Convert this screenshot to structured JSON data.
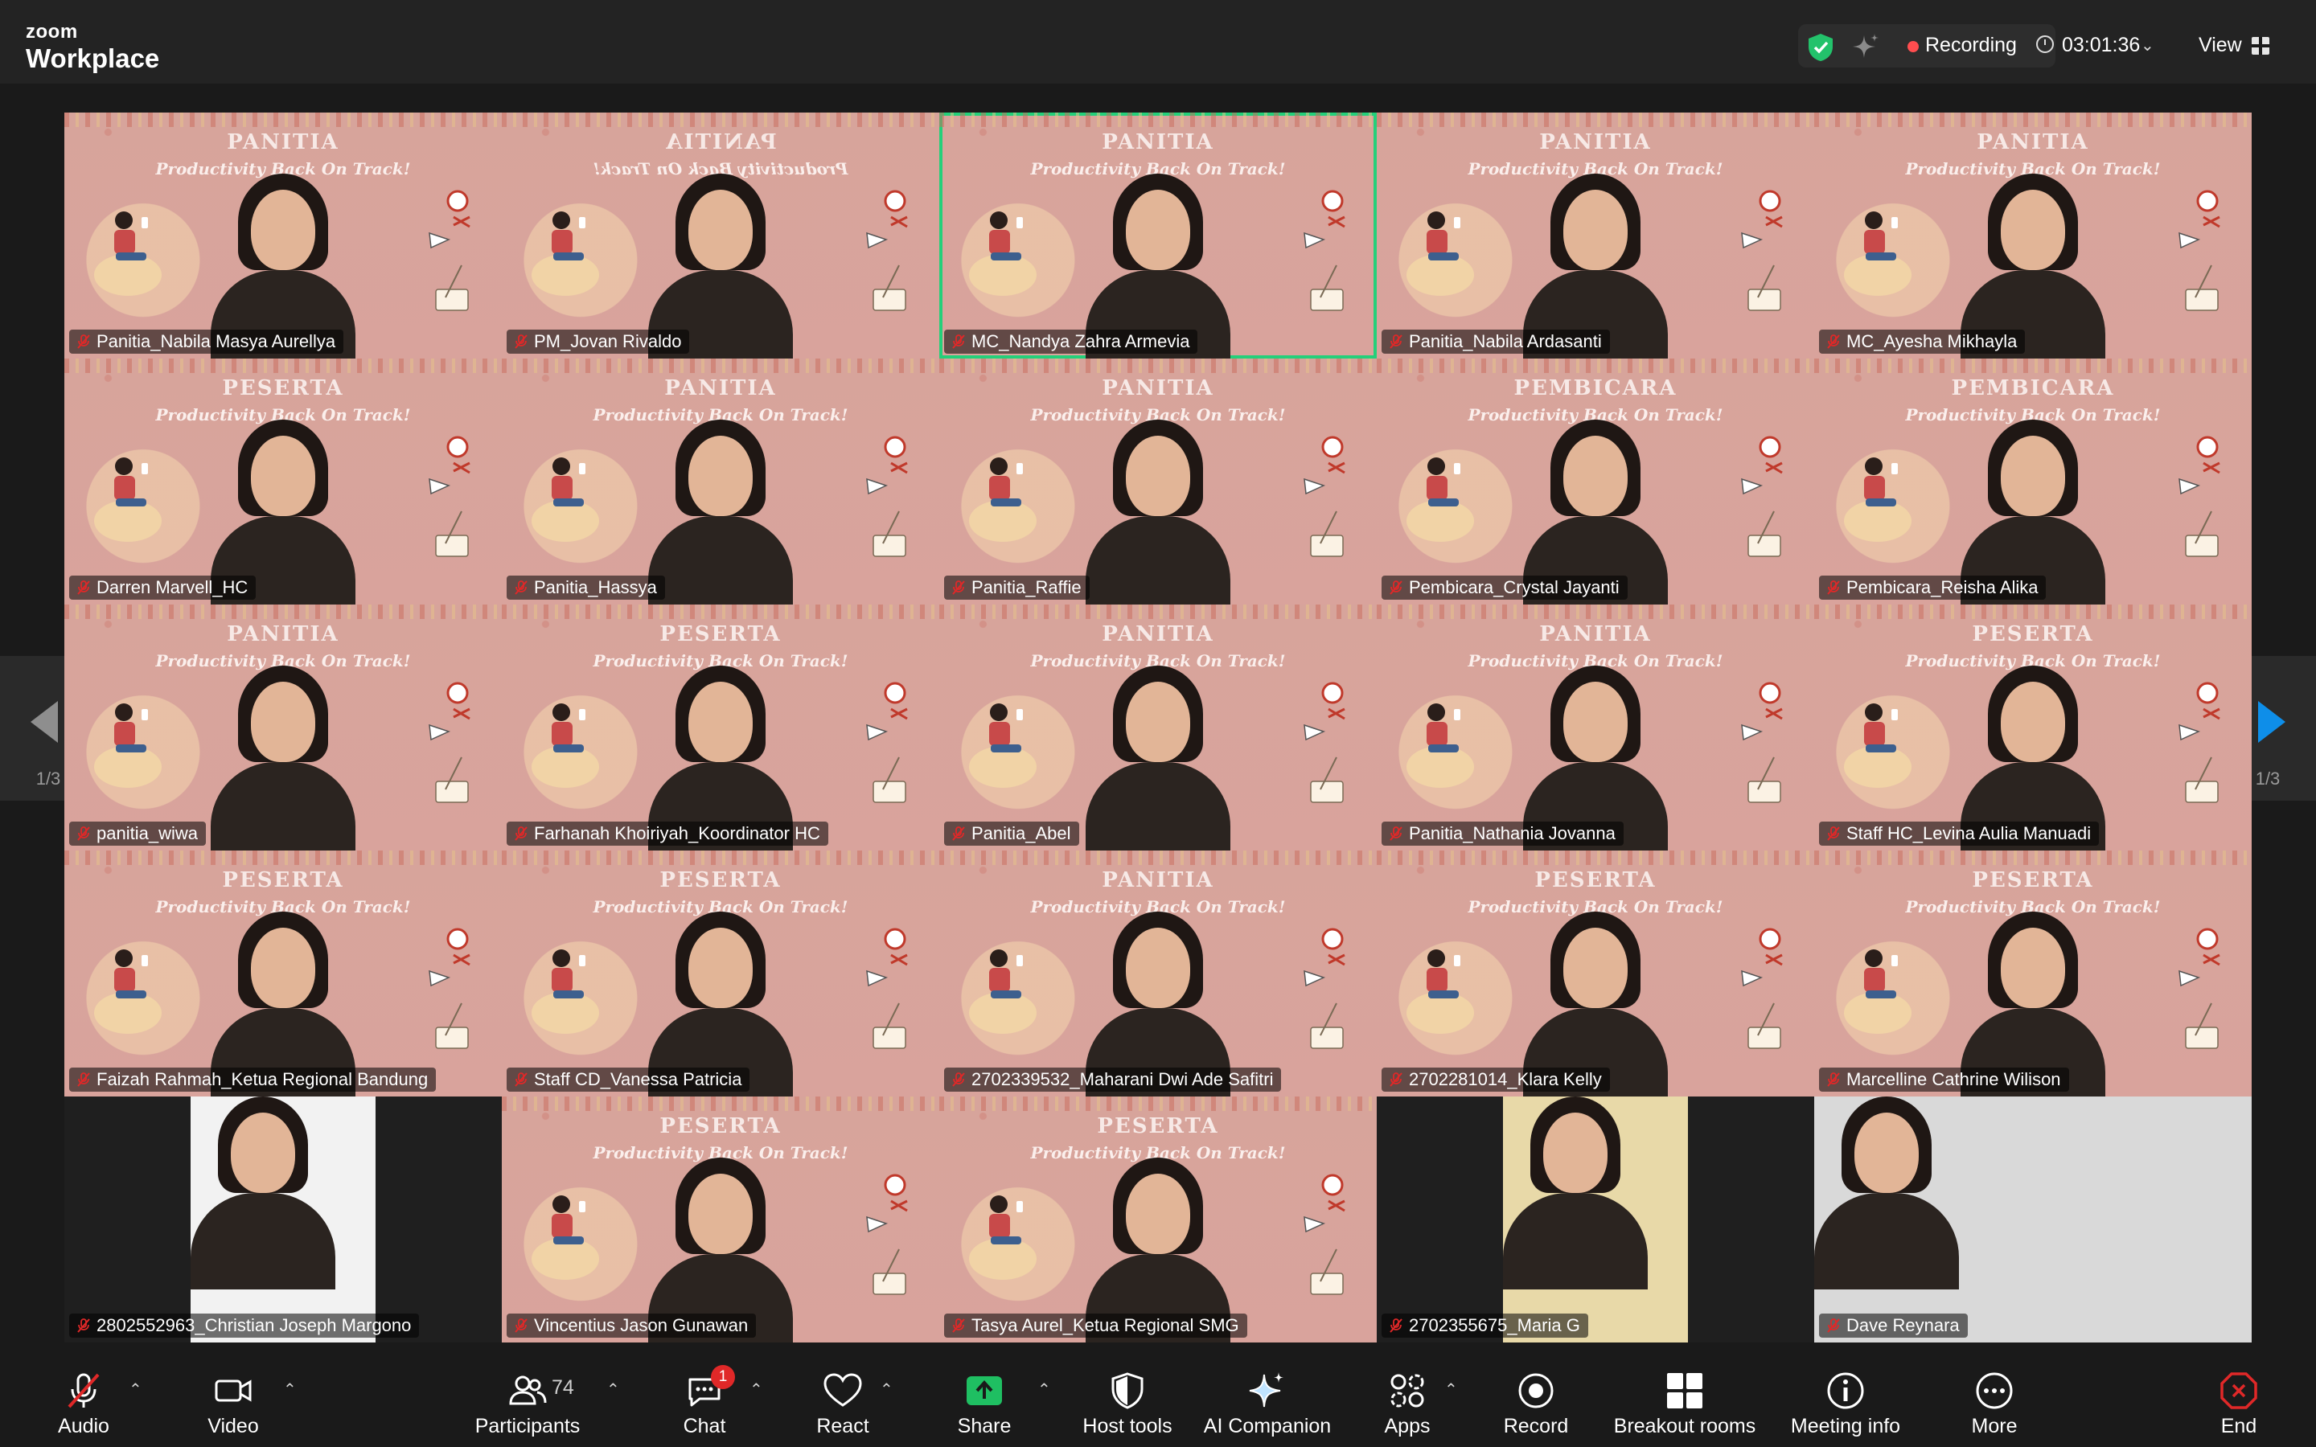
{
  "app": {
    "brand_top": "zoom",
    "brand_bottom": "Workplace"
  },
  "header": {
    "recording_label": "Recording",
    "timer": "03:01:36",
    "view_label": "View",
    "colors": {
      "shield": "#23c26b",
      "recording_dot": "#ff4d4f"
    }
  },
  "gallery": {
    "page_left": "1/3",
    "page_right": "1/3",
    "tiles": [
      {
        "name": "Panitia_Nabila Masya Aurellya",
        "banner": "PANITIA",
        "tagline": "Productivity Back On Track!"
      },
      {
        "name": "PM_Jovan Rivaldo",
        "banner": "PANITIA",
        "tagline": "Productivity Back On Track!"
      },
      {
        "name": "MC_Nandya Zahra Armevia",
        "banner": "PANITIA",
        "tagline": "Productivity Back On Track!"
      },
      {
        "name": "Panitia_Nabila Ardasanti",
        "banner": "PANITIA",
        "tagline": "Productivity Back On Track!"
      },
      {
        "name": "MC_Ayesha Mikhayla",
        "banner": "PANITIA",
        "tagline": "Productivity Back On Track!"
      },
      {
        "name": "Darren Marvell_HC",
        "banner": "PESERTA",
        "tagline": "Productivity Back On Track!"
      },
      {
        "name": "Panitia_Hassya",
        "banner": "PANITIA",
        "tagline": "Productivity Back On Track!"
      },
      {
        "name": "Panitia_Raffie",
        "banner": "PANITIA",
        "tagline": "Productivity Back On Track!"
      },
      {
        "name": "Pembicara_Crystal Jayanti",
        "banner": "PEMBICARA",
        "tagline": "Productivity Back On Track!"
      },
      {
        "name": "Pembicara_Reisha Alika",
        "banner": "PEMBICARA",
        "tagline": "Productivity Back On Track!"
      },
      {
        "name": "panitia_wiwa",
        "banner": "PANITIA",
        "tagline": "Productivity Back On Track!"
      },
      {
        "name": "Farhanah Khoiriyah_Koordinator HC",
        "banner": "PESERTA",
        "tagline": "Productivity Back On Track!"
      },
      {
        "name": "Panitia_Abel",
        "banner": "PANITIA",
        "tagline": "Productivity Back On Track!"
      },
      {
        "name": "Panitia_Nathania Jovanna",
        "banner": "PANITIA",
        "tagline": "Productivity Back On Track!"
      },
      {
        "name": "Staff HC_Levina Aulia Manuadi",
        "banner": "PESERTA",
        "tagline": "Productivity Back On Track!"
      },
      {
        "name": "Faizah Rahmah_Ketua Regional Bandung",
        "banner": "PESERTA",
        "tagline": "Productivity Back On Track!"
      },
      {
        "name": "Staff CD_Vanessa Patricia",
        "banner": "PESERTA",
        "tagline": "Productivity Back On Track!"
      },
      {
        "name": "2702339532_Maharani Dwi Ade Safitri",
        "banner": "PANITIA",
        "tagline": "Productivity Back On Track!"
      },
      {
        "name": "2702281014_Klara Kelly",
        "banner": "PESERTA",
        "tagline": "Productivity Back On Track!"
      },
      {
        "name": "Marcelline Cathrine Wilison",
        "banner": "PESERTA",
        "tagline": "Productivity Back On Track!"
      },
      {
        "name": "2802552963_Christian Joseph Margono",
        "banner": "",
        "tagline": ""
      },
      {
        "name": "Vincentius Jason Gunawan",
        "banner": "PESERTA",
        "tagline": "Productivity Back On Track!"
      },
      {
        "name": "Tasya Aurel_Ketua Regional SMG",
        "banner": "PESERTA",
        "tagline": "Productivity Back On Track!"
      },
      {
        "name": "2702355675_Maria G",
        "banner": "",
        "tagline": ""
      },
      {
        "name": "Dave Reynara",
        "banner": "",
        "tagline": ""
      }
    ],
    "active_speaker_color": "#24d07a"
  },
  "toolbar": {
    "audio": "Audio",
    "video": "Video",
    "participants": "Participants",
    "participants_count": "74",
    "chat": "Chat",
    "chat_badge": "1",
    "react": "React",
    "share": "Share",
    "host_tools": "Host tools",
    "ai_companion": "AI Companion",
    "apps": "Apps",
    "record": "Record",
    "breakout": "Breakout rooms",
    "meeting_info": "Meeting info",
    "more": "More",
    "end": "End",
    "colors": {
      "share": "#1fbf62",
      "end": "#e02828",
      "muted": "#e02828"
    }
  }
}
